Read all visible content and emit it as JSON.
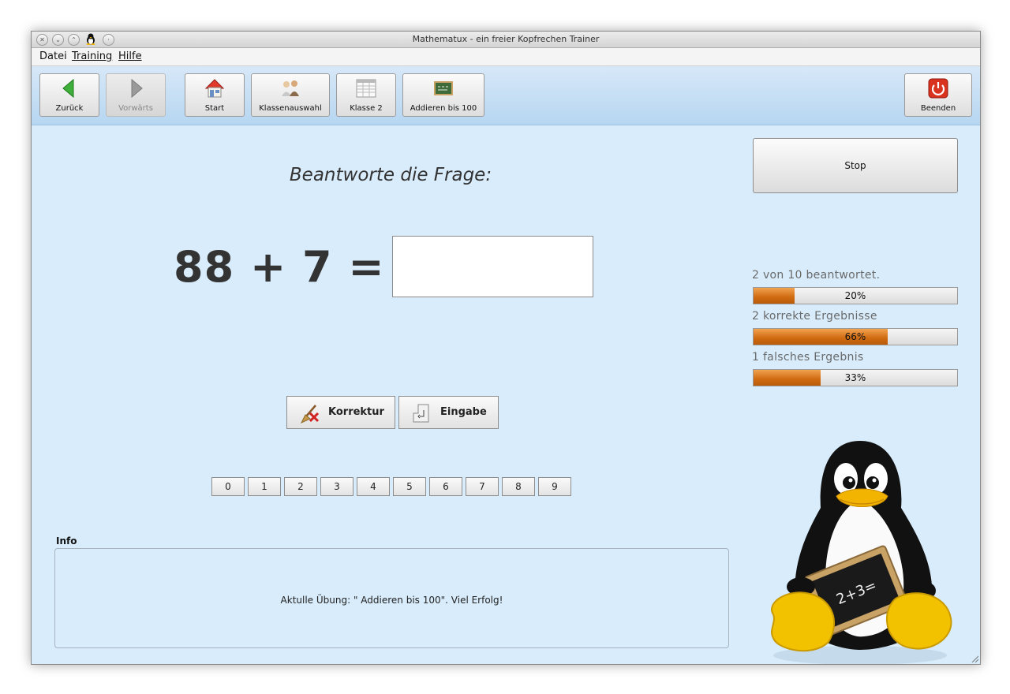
{
  "window": {
    "title": "Mathematux - ein freier Kopfrechen Trainer"
  },
  "menu": [
    {
      "label": "Datei"
    },
    {
      "label": "Training"
    },
    {
      "label": "Hilfe"
    }
  ],
  "toolbar": {
    "back": "Zurück",
    "forward": "Vorwärts",
    "start": "Start",
    "class_select": "Klassenauswahl",
    "class": "Klasse 2",
    "exercise": "Addieren bis 100",
    "quit": "Beenden"
  },
  "main": {
    "question": "Beantworte die Frage:",
    "equation": "88 + 7 =",
    "answer_value": "",
    "correction_label": "Korrektur",
    "enter_label": "Eingabe",
    "digits": [
      "0",
      "1",
      "2",
      "3",
      "4",
      "5",
      "6",
      "7",
      "8",
      "9"
    ]
  },
  "info": {
    "label": "Info",
    "text": "Aktulle Übung: \" Addieren bis 100\". Viel Erfolg!"
  },
  "side": {
    "stop_label": "Stop",
    "answered_text": "2 von 10 beantwortet.",
    "answered_pct": "20%",
    "answered_fraction": 0.2,
    "correct_text": "2 korrekte Ergebnisse",
    "correct_pct": "66%",
    "correct_fraction": 0.66,
    "wrong_text": "1 falsches Ergebnis",
    "wrong_pct": "33%",
    "wrong_fraction": 0.33,
    "slate_text": "2+3="
  },
  "colors": {
    "accent": "#d8ecfb",
    "progress": "#e07a1e"
  }
}
